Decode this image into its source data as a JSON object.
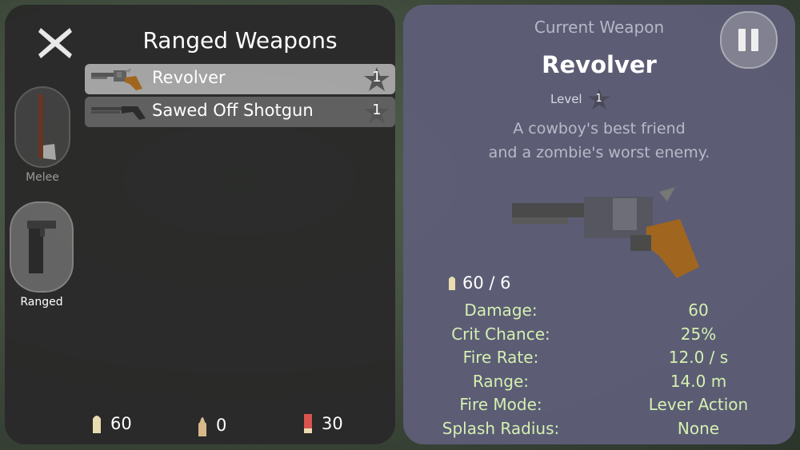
{
  "left_panel": {
    "title": "Ranged Weapons",
    "weapons": [
      {
        "name": "Revolver",
        "level": "1",
        "selected": true
      },
      {
        "name": "Sawed Off Shotgun",
        "level": "1",
        "selected": false
      }
    ],
    "categories": [
      {
        "label": "Melee",
        "icon": "axe-icon",
        "active": false
      },
      {
        "label": "Ranged",
        "icon": "pistol-icon",
        "active": true
      }
    ],
    "ammo": [
      {
        "icon": "pistol-bullet-icon",
        "count": "60"
      },
      {
        "icon": "rifle-bullet-icon",
        "count": "0"
      },
      {
        "icon": "shotgun-shell-icon",
        "count": "30"
      }
    ]
  },
  "right_panel": {
    "header": "Current Weapon",
    "weapon_name": "Revolver",
    "level_label": "Level",
    "level_value": "1",
    "description_line1": "A cowboy's best friend",
    "description_line2": "and a zombie's worst enemy.",
    "ammo_readout": "60 / 6",
    "stats": [
      {
        "label": "Damage:",
        "value": "60"
      },
      {
        "label": "Crit Chance:",
        "value": "25%"
      },
      {
        "label": "Fire Rate:",
        "value": "12.0 / s"
      },
      {
        "label": "Range:",
        "value": "14.0 m"
      },
      {
        "label": "Fire Mode:",
        "value": "Lever Action"
      },
      {
        "label": "Splash Radius:",
        "value": "None"
      }
    ]
  },
  "colors": {
    "stat_text": "#d4f0b0",
    "left_panel_bg": "#282828",
    "right_panel_bg": "#5e5e78",
    "selected_row": "#cdcdcd",
    "shotgun_shell_red": "#d9534f",
    "bullet_tan": "#e8dcb0"
  },
  "icons": {
    "close": "close-x-icon",
    "pause": "pause-icon",
    "level_star": "star-icon"
  }
}
